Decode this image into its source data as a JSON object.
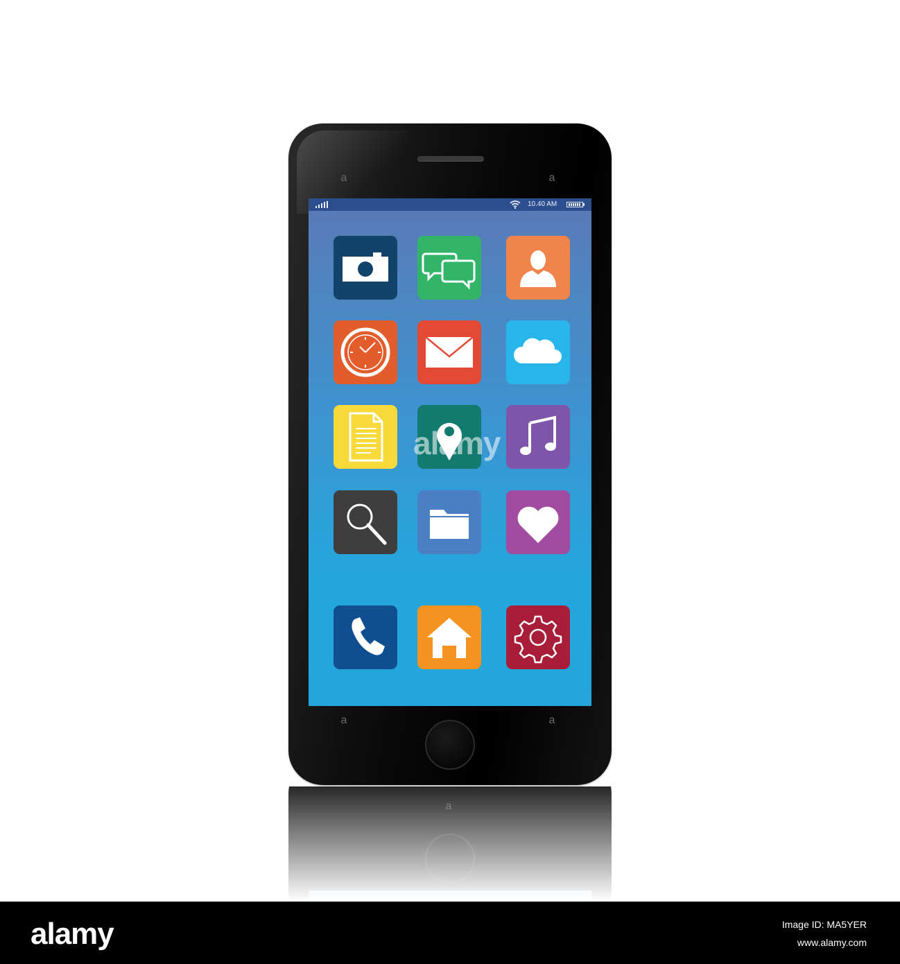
{
  "status_bar": {
    "time": "10.40 AM"
  },
  "apps": [
    {
      "name": "camera",
      "icon": "camera-icon",
      "color": "#12436b"
    },
    {
      "name": "messages",
      "icon": "chat-bubbles-icon",
      "color": "#33b569"
    },
    {
      "name": "contacts",
      "icon": "person-icon",
      "color": "#f1844b"
    },
    {
      "name": "clock",
      "icon": "clock-icon",
      "color": "#e35c2b"
    },
    {
      "name": "mail",
      "icon": "envelope-icon",
      "color": "#e34a35"
    },
    {
      "name": "cloud",
      "icon": "cloud-icon",
      "color": "#27b5ea"
    },
    {
      "name": "notes",
      "icon": "document-icon",
      "color": "#f7d93a"
    },
    {
      "name": "maps",
      "icon": "map-pin-icon",
      "color": "#127a6f"
    },
    {
      "name": "music",
      "icon": "music-note-icon",
      "color": "#7e55a8"
    },
    {
      "name": "search",
      "icon": "magnifier-icon",
      "color": "#3e3e3e"
    },
    {
      "name": "files",
      "icon": "folder-icon",
      "color": "#4a7fc4"
    },
    {
      "name": "favorites",
      "icon": "heart-icon",
      "color": "#a14ca0"
    }
  ],
  "dock": [
    {
      "name": "phone",
      "icon": "phone-handset-icon",
      "color": "#0f4e8f"
    },
    {
      "name": "home",
      "icon": "house-icon",
      "color": "#f69220"
    },
    {
      "name": "settings",
      "icon": "gear-icon",
      "color": "#a81e39"
    }
  ],
  "watermark": "alamy",
  "footer": {
    "logo": "alamy",
    "image_id": "Image ID: MA5YER",
    "site": "www.alamy.com"
  }
}
